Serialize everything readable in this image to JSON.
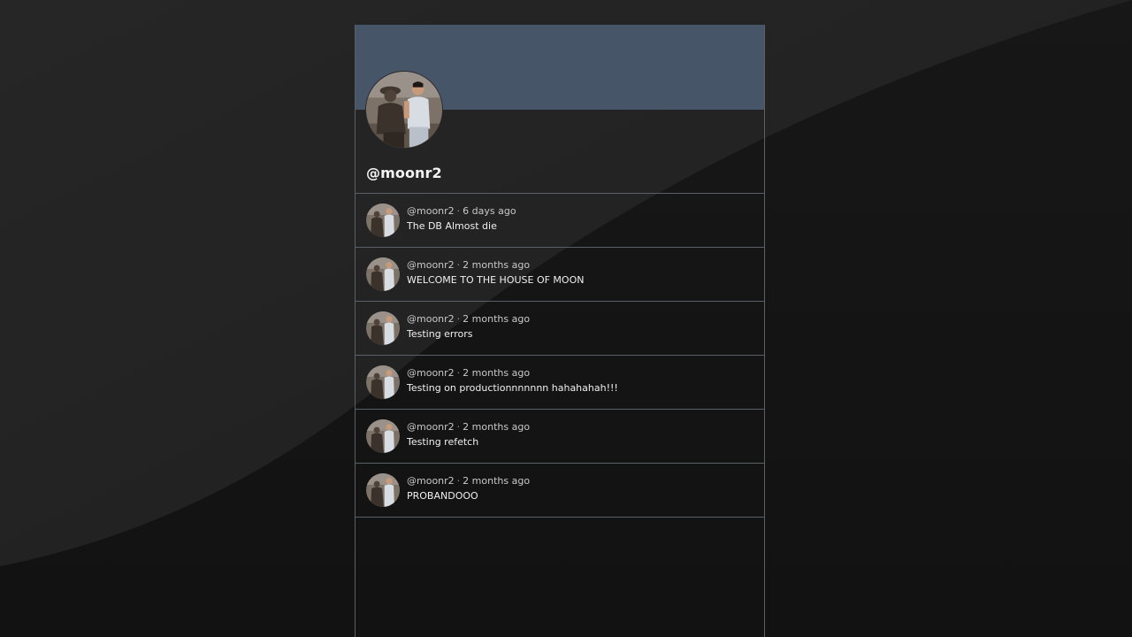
{
  "profile": {
    "username": "@moonr2",
    "banner_color": "#475569"
  },
  "icons": {
    "avatar": "profile-photo-avatar"
  },
  "posts": [
    {
      "author": "@moonr2",
      "time": "6 days ago",
      "text": "The DB Almost die"
    },
    {
      "author": "@moonr2",
      "time": "2 months ago",
      "text": "WELCOME TO THE HOUSE OF MOON"
    },
    {
      "author": "@moonr2",
      "time": "2 months ago",
      "text": "Testing errors"
    },
    {
      "author": "@moonr2",
      "time": "2 months ago",
      "text": "Testing on productionnnnnnn hahahahah!!!"
    },
    {
      "author": "@moonr2",
      "time": "2 months ago",
      "text": "Testing refetch"
    },
    {
      "author": "@moonr2",
      "time": "2 months ago",
      "text": "PROBANDOOO"
    }
  ]
}
